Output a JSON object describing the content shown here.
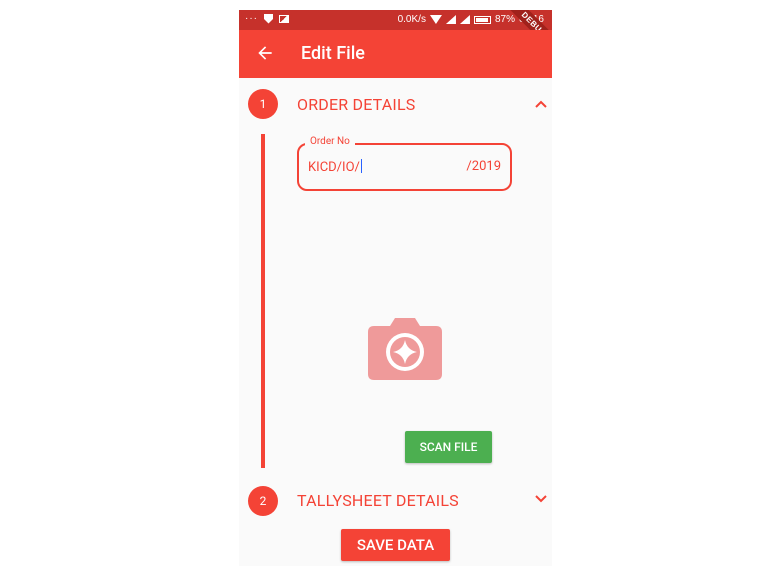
{
  "status_bar": {
    "ellipsis": "···",
    "network_speed": "0.0K/s",
    "battery": "87%",
    "time": "07:16",
    "debug_banner": "DEBUG"
  },
  "app_bar": {
    "title": "Edit File",
    "back_icon": "arrow-back-icon"
  },
  "stepper": {
    "steps": [
      {
        "number": "1",
        "title": "ORDER DETAILS",
        "expanded": true,
        "icon": "chevron-up-icon"
      },
      {
        "number": "2",
        "title": "TALLYSHEET DETAILS",
        "expanded": false,
        "icon": "chevron-down-icon"
      }
    ]
  },
  "order_no_field": {
    "label": "Order No",
    "prefix": "KICD/IO/",
    "value": "",
    "suffix": "/2019"
  },
  "camera": {
    "icon": "camera-icon"
  },
  "buttons": {
    "scan_file": "SCAN FILE",
    "save_data": "SAVE DATA"
  },
  "colors": {
    "primary": "#f44336",
    "status_bar": "#c6312b",
    "scan_button": "#4caf50",
    "camera_icon": "#ef9a9a",
    "background": "#fafafa"
  }
}
